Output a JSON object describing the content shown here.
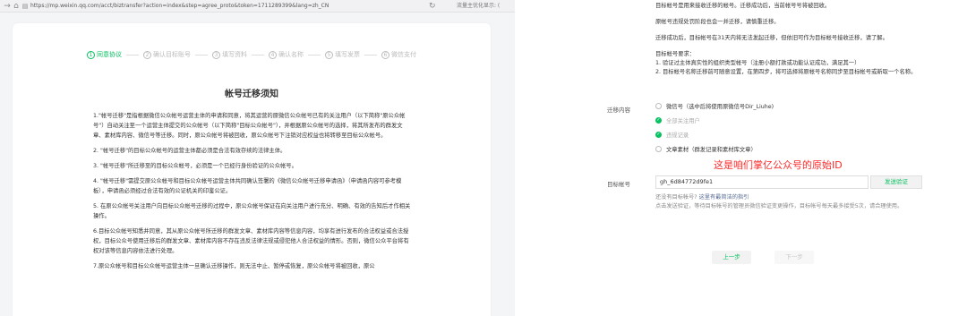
{
  "browser": {
    "url": "https://mp.weixin.qq.com/acct/biztransfer?action=index&step=agree_proto&token=1711289399&lang=zh_CN",
    "speed_text": "流量主优化显示: ("
  },
  "steps": [
    {
      "num": "1",
      "label": "同意协议"
    },
    {
      "num": "2",
      "label": "确认目标账号"
    },
    {
      "num": "3",
      "label": "填写资料"
    },
    {
      "num": "4",
      "label": "确认名称"
    },
    {
      "num": "5",
      "label": "填写发票"
    },
    {
      "num": "6",
      "label": "微信支付"
    }
  ],
  "document": {
    "title": "帐号迁移须知",
    "paragraphs": [
      "1.\"帐号迁移\"是指根据微信公众帐号运营主体的申请和同意，将其运营的原微信公众帐号已有的关注用户（以下简称\"原公众帐号\"）自动关注至一个运营主体提交的公众帐号（以下简称\"目标公众帐号\"），并根据原公众帐号的选择，将其所发布的群发文章、素材库内容、微信号等迁移。同时，原公众帐号将被回收，原公众帐号下注销对应权益也将转移至目标公众帐号。",
      "2. \"帐号迁移\"的目标公众帐号的运营主体都必须是合法有效存续的法律主体。",
      "3. \"帐号迁移\"所迁移至的目标公众帐号，必须是一个已经行身份验证的公众帐号。",
      "4. \"帐号迁移\"需提交原公众帐号和目标公众帐号运营主体共同确认签署的《微信公众帐号迁移申请函》（申请函内容可参考模板），申请函必须经过合法有效的公证机关的印鉴公证。",
      "5. 在原公众帐号关注用户向目标公众帐号迁移的过程中，原公众帐号保证在向关注用户进行充分、明确、有效的告知后才作相关操作。",
      "6.目标公众帐号知悉并同意，其从原公众帐号所迁移的群发文章、素材库内容等信息内容，均享有进行发布的合法权益或合法授权，目标公众号使用迁移后的群发文章、素材库内容不存在违反法律法规或侵犯他人合法权益的情形。否则，微信公众平台将有权对该等信息内容依法进行处理。",
      "7.原公众帐号和目标公众帐号运营主体一旦确认迁移操作，则无法中止、暂停或恢复，原公众帐号将被回收，原公"
    ]
  },
  "right_panel": {
    "notes": [
      "目标帐号是用来接收迁移的帐号。迁移成功后，当前帐号号将被回收。",
      "原帐号违规处罚阶段也会一并迁移，请慎重迁移。",
      "迁移成功后，目标帐号在31天内将无法发起迁移，但依旧可作为目标帐号接收迁移，请了解。",
      "目标帐号要求：\n1. 验证过主体真实性的组织类型帐号（注册小额打款或功能认证成功，满足其一）\n2. 目标帐号名称迁移前可随意设置，在第四步，将可选择将原帐号名称同步至目标帐号或新取一个名称。"
    ],
    "migrate_label": "迁移内容",
    "options": [
      {
        "label": "微信号（选中后将使用原微信号Dir_Liuhe)",
        "state": "unchecked"
      },
      {
        "label": "全部关注用户",
        "state": "checked"
      },
      {
        "label": "违规记录",
        "state": "checked"
      },
      {
        "label": "文章素材（群发记录和素材库文章）",
        "state": "unchecked"
      }
    ],
    "annotation": "这是咱们掌亿公众号的原始ID",
    "target_label": "目标帐号",
    "target_value": "gh_6d84772d9fe1",
    "send_button": "发送验证",
    "help_prefix": "还没有目标帐号?",
    "help_link": "这里有最简洁的指引",
    "help_text": "点击发送验证，等待目标帐号的管理员微信验证变更操作，目标帐号每天最多接受5次，请合理使用。",
    "prev_button": "上一步",
    "next_button": "下一步"
  },
  "colors": {
    "accent": "#07c160",
    "annotation": "#ff2a2a",
    "link": "#576b95"
  }
}
